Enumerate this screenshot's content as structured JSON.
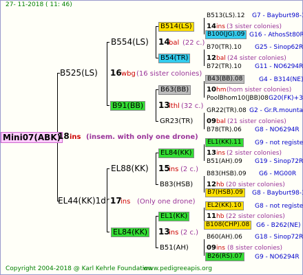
{
  "header": {
    "date": "27- 11-2018 ( 11: 46)"
  },
  "root": {
    "name": "Mini07(ABK)",
    "gen": "18",
    "mark": "ins",
    "note": "(insem. with only one drone)"
  },
  "g1": [
    {
      "name": "B525(LS)",
      "gen": "16",
      "mark": "wbg",
      "note": "(16 sister colonies)"
    },
    {
      "name": "EL44(KK)1dr",
      "gen": "17",
      "mark": "ins",
      "note": "(Only one drone)"
    }
  ],
  "g2": [
    {
      "name": "B554(LS)",
      "gen": "14",
      "mark": "bal",
      "note": "(22 c.)"
    },
    {
      "name": "B91(BB)",
      "gen": "13",
      "mark": "lthl",
      "note": "(32 c.)"
    },
    {
      "name": "EL88(KK)",
      "gen": "15",
      "mark": "ins",
      "note": "(2 c.)"
    },
    {
      "name": "EL84(KK)",
      "gen": "13",
      "mark": "ins",
      "note": "(2 c.)"
    }
  ],
  "g3": [
    {
      "name": "B514(LS)",
      "gen": "14",
      "mark": "ins",
      "note": "(3 sister colonies)"
    },
    {
      "name": "B54(TR)",
      "gen": "12",
      "mark": "bal",
      "note": "(24 sister colonies)"
    },
    {
      "name": "B63(BB)",
      "gen": "10",
      "mark": "hm",
      "note": "(hom sister colonies)"
    },
    {
      "name": "GR23(TR)",
      "gen": "09",
      "mark": "bal",
      "note": "(21 sister colonies)"
    },
    {
      "name": "EL84(KK)",
      "gen": "13",
      "mark": "ins",
      "note": "(2 sister colonies)"
    },
    {
      "name": "B83(HSB)",
      "gen": "12",
      "mark": "hb",
      "note": "(20 sister colonies)"
    },
    {
      "name": "EL1(KK)",
      "gen": "11",
      "mark": "hb",
      "note": "(22 sister colonies)"
    },
    {
      "name": "B51(AH)",
      "gen": "09",
      "mark": "ins",
      "note": "(8 sister colonies)"
    }
  ],
  "g4": [
    {
      "name": "B513(LS).12",
      "ref": "G7 - Bayburt98-3"
    },
    {
      "name": "B100(JG).09",
      "ref": "G16 - AthosSt80R"
    },
    {
      "name": "B70(TR).10",
      "ref": "G25 - Sinop62R"
    },
    {
      "name": "B72(TR).10",
      "ref": "G11 - NO6294R"
    },
    {
      "name": "B43(BB).08",
      "ref": "G4 - B314(NE)"
    },
    {
      "name": "PoolBhom10(JBB)08",
      "ref": "G20(FK)+3"
    },
    {
      "name": "GR22(TR).08",
      "ref": "G2 - Gr.R.mounta"
    },
    {
      "name": "B78(TR).06",
      "ref": "G8 - NO6294R"
    },
    {
      "name": "EL1(KK).11",
      "ref": "G9 - not registe"
    },
    {
      "name": "B51(AH).09",
      "ref": "G19 - Sinop72R"
    },
    {
      "name": "B83(HSB).09",
      "ref": "G6 - MG00R"
    },
    {
      "name": "B7(HSB).09",
      "ref": "G8 - Bayburt98-3"
    },
    {
      "name": "EL2(KK).10",
      "ref": "G8 - not registe"
    },
    {
      "name": "B108(CHP).08",
      "ref": "G6 - B262(NE)"
    },
    {
      "name": "B60(AH).06",
      "ref": "G18 - Sinop72R"
    },
    {
      "name": "B26(RS).07",
      "ref": "G9 - NO6294R"
    }
  ],
  "footer": {
    "copyright": "Copyright 2004-2018 @ Karl Kehrle Foundation",
    "site": "www.pedigreeapis.org"
  }
}
